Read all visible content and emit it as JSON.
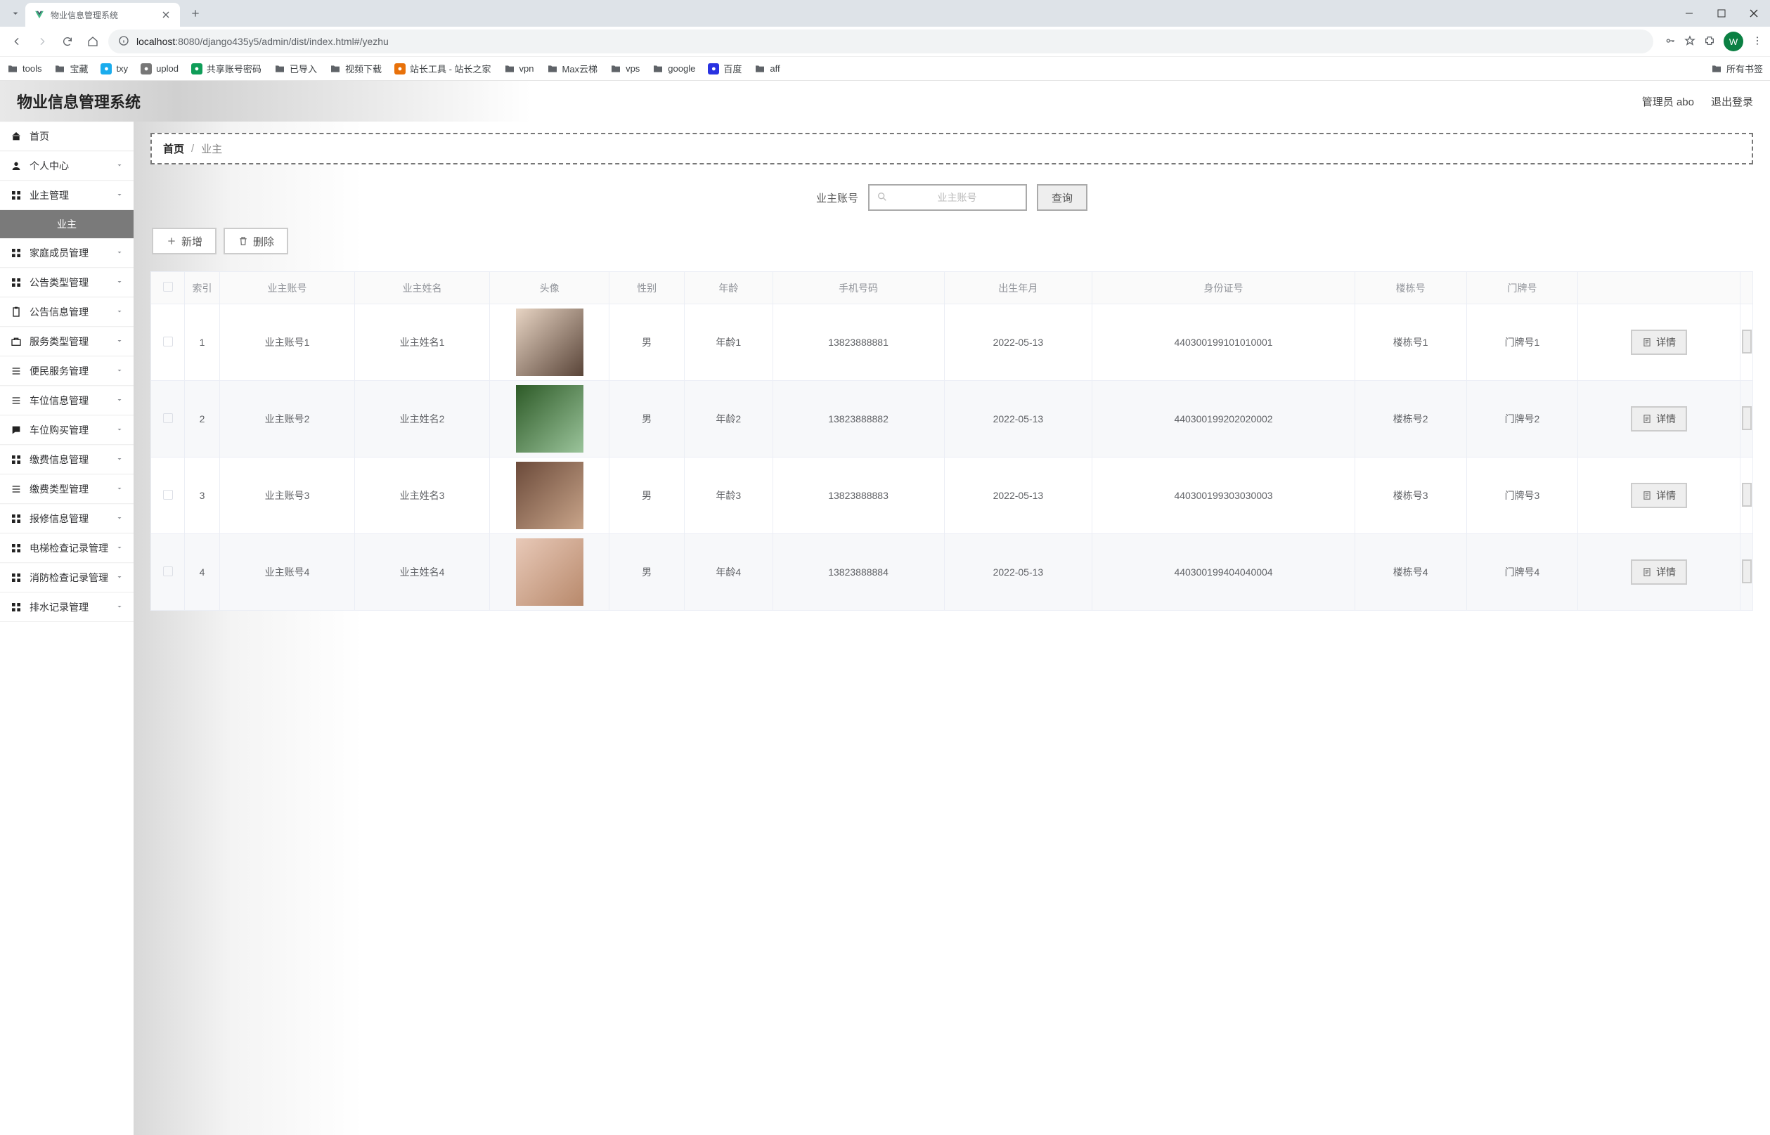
{
  "browser": {
    "tab_title": "物业信息管理系统",
    "url_host": "localhost",
    "url_port": ":8080",
    "url_path": "/django435y5/admin/dist/index.html#/yezhu",
    "avatar_letter": "W",
    "bookmarks": [
      {
        "label": "tools",
        "type": "folder"
      },
      {
        "label": "宝藏",
        "type": "folder"
      },
      {
        "label": "txy",
        "type": "fav",
        "color": "#1aaced"
      },
      {
        "label": "uplod",
        "type": "fav",
        "color": "#777"
      },
      {
        "label": "共享账号密码",
        "type": "fav",
        "color": "#0f9d58"
      },
      {
        "label": "已导入",
        "type": "folder"
      },
      {
        "label": "视频下载",
        "type": "folder"
      },
      {
        "label": "站长工具 - 站长之家",
        "type": "fav",
        "color": "#e8710a"
      },
      {
        "label": "vpn",
        "type": "folder"
      },
      {
        "label": "Max云梯",
        "type": "folder"
      },
      {
        "label": "vps",
        "type": "folder"
      },
      {
        "label": "google",
        "type": "folder"
      },
      {
        "label": "百度",
        "type": "fav",
        "color": "#2932e1"
      },
      {
        "label": "aff",
        "type": "folder"
      }
    ],
    "all_bookmarks_label": "所有书签"
  },
  "header": {
    "title": "物业信息管理系统",
    "admin_label": "管理员 abo",
    "logout_label": "退出登录"
  },
  "sidebar": {
    "items": [
      {
        "label": "首页",
        "icon": "home",
        "expandable": false
      },
      {
        "label": "个人中心",
        "icon": "user",
        "expandable": true
      },
      {
        "label": "业主管理",
        "icon": "grid",
        "expandable": true
      },
      {
        "label": "家庭成员管理",
        "icon": "grid",
        "expandable": true
      },
      {
        "label": "公告类型管理",
        "icon": "grid",
        "expandable": true
      },
      {
        "label": "公告信息管理",
        "icon": "clipboard",
        "expandable": true
      },
      {
        "label": "服务类型管理",
        "icon": "briefcase",
        "expandable": true
      },
      {
        "label": "便民服务管理",
        "icon": "list",
        "expandable": true
      },
      {
        "label": "车位信息管理",
        "icon": "list",
        "expandable": true
      },
      {
        "label": "车位购买管理",
        "icon": "chat",
        "expandable": true
      },
      {
        "label": "缴费信息管理",
        "icon": "grid",
        "expandable": true
      },
      {
        "label": "缴费类型管理",
        "icon": "list",
        "expandable": true
      },
      {
        "label": "报修信息管理",
        "icon": "grid",
        "expandable": true
      },
      {
        "label": "电梯检查记录管理",
        "icon": "grid",
        "expandable": true
      },
      {
        "label": "消防检查记录管理",
        "icon": "grid",
        "expandable": true
      },
      {
        "label": "排水记录管理",
        "icon": "grid",
        "expandable": true
      }
    ],
    "active_sub": "业主",
    "active_sub_parent_index": 2
  },
  "breadcrumb": {
    "home": "首页",
    "current": "业主"
  },
  "search": {
    "label": "业主账号",
    "placeholder": "业主账号",
    "button": "查询"
  },
  "actions": {
    "add": "新增",
    "delete": "删除"
  },
  "table": {
    "headers": [
      "索引",
      "业主账号",
      "业主姓名",
      "头像",
      "性别",
      "年龄",
      "手机号码",
      "出生年月",
      "身份证号",
      "楼栋号",
      "门牌号"
    ],
    "detail_label": "详情",
    "rows": [
      {
        "idx": "1",
        "account": "业主账号1",
        "name": "业主姓名1",
        "gender": "男",
        "age": "年龄1",
        "phone": "13823888881",
        "birth": "2022-05-13",
        "idno": "440300199101010001",
        "building": "楼栋号1",
        "door": "门牌号1"
      },
      {
        "idx": "2",
        "account": "业主账号2",
        "name": "业主姓名2",
        "gender": "男",
        "age": "年龄2",
        "phone": "13823888882",
        "birth": "2022-05-13",
        "idno": "440300199202020002",
        "building": "楼栋号2",
        "door": "门牌号2"
      },
      {
        "idx": "3",
        "account": "业主账号3",
        "name": "业主姓名3",
        "gender": "男",
        "age": "年龄3",
        "phone": "13823888883",
        "birth": "2022-05-13",
        "idno": "440300199303030003",
        "building": "楼栋号3",
        "door": "门牌号3"
      },
      {
        "idx": "4",
        "account": "业主账号4",
        "name": "业主姓名4",
        "gender": "男",
        "age": "年龄4",
        "phone": "13823888884",
        "birth": "2022-05-13",
        "idno": "440300199404040004",
        "building": "楼栋号4",
        "door": "门牌号4"
      }
    ]
  }
}
